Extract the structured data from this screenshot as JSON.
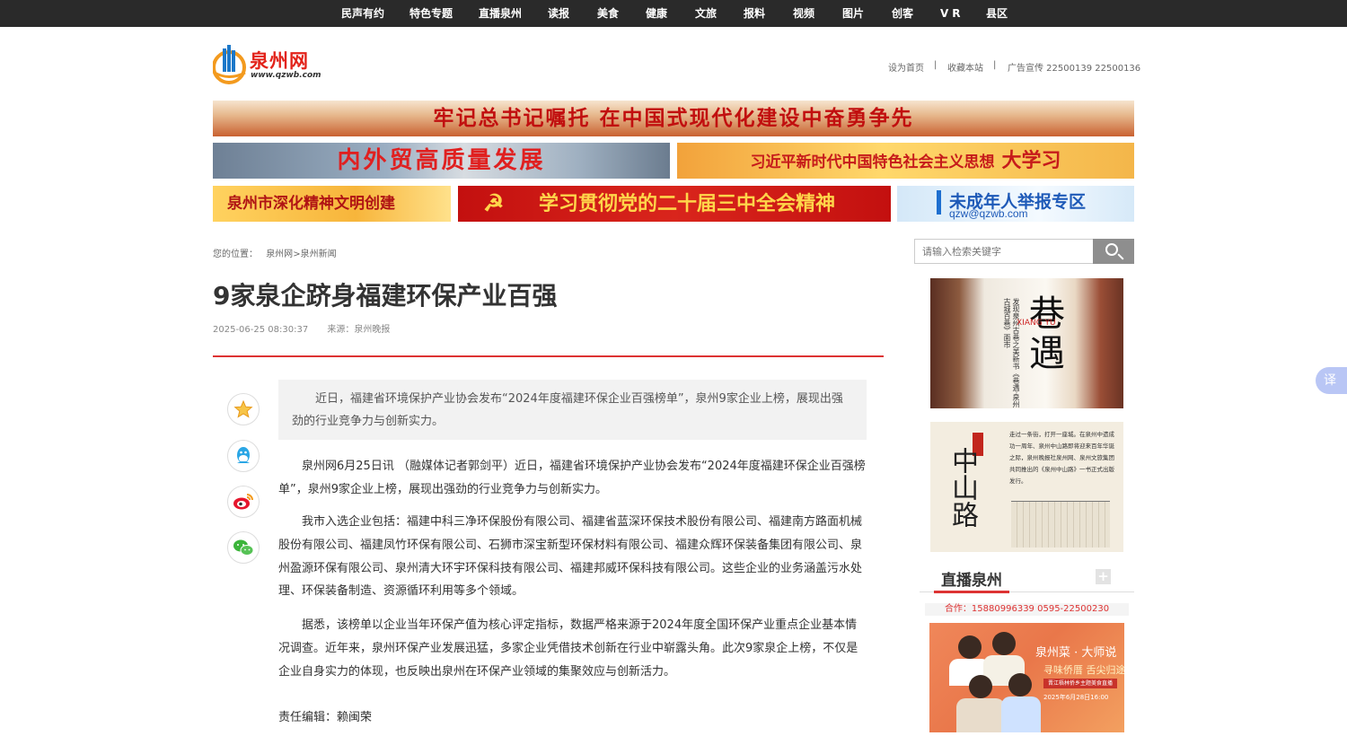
{
  "topnav": {
    "items": [
      "民声有约",
      "特色专题",
      "直播泉州",
      "读报",
      "美食",
      "健康",
      "文旅",
      "报料",
      "视频",
      "图片",
      "创客",
      "VR",
      "县区"
    ]
  },
  "header": {
    "logo_text": "泉州网",
    "logo_url": "www.qzwb.com",
    "links": [
      "设为首页",
      "收藏本站",
      "广告宣传 22500139 22500136"
    ],
    "separator": "|"
  },
  "banners": {
    "b1": "牢记总书记嘱托 在中国式现代化建设中奋勇争先",
    "b2": "内外贸高质量发展",
    "b3_small": "习近平新时代中国特色社会主义思想",
    "b3_big": "大学习",
    "b4": "泉州市深化精神文明创建",
    "b5": "学习贯彻党的二十届三中全会精神",
    "b6_title": "未成年人举报专区",
    "b6_email": "qzw@qzwb.com"
  },
  "breadcrumb": {
    "prefix": "您的位置：",
    "home": "泉州网",
    "sep": ">",
    "section": "泉州新闻"
  },
  "article": {
    "title": "9家泉企跻身福建环保产业百强",
    "datetime": "2025-06-25 08:30:37",
    "source_label": "来源：泉州晚报",
    "summary": "近日，福建省环境保护产业协会发布“2024年度福建环保企业百强榜单”，泉州9家企业上榜，展现出强劲的行业竞争力与创新实力。",
    "paragraphs": [
      "泉州网6月25日讯 （融媒体记者郭剑平）近日，福建省环境保护产业协会发布“2024年度福建环保企业百强榜单”，泉州9家企业上榜，展现出强劲的行业竞争力与创新实力。",
      "我市入选企业包括：福建中科三净环保股份有限公司、福建省蓝深环保技术股份有限公司、福建南方路面机械股份有限公司、福建凤竹环保有限公司、石狮市深宝新型环保材料有限公司、福建众辉环保装备集团有限公司、泉州盈源环保有限公司、泉州清大环宇环保科技有限公司、福建邦威环保科技有限公司。这些企业的业务涵盖污水处理、环保装备制造、资源循环利用等多个领域。",
      "据悉，该榜单以企业当年环保产值为核心评定指标，数据严格来源于2024年度全国环保产业重点企业基本情况调查。近年来，泉州环保产业发展迅猛，多家企业凭借技术创新在行业中崭露头角。此次9家泉企上榜，不仅是企业自身实力的体现，也反映出泉州在环保产业领域的集聚效应与创新活力。"
    ],
    "editor": "责任编辑：赖闽荣"
  },
  "share": {
    "icons": [
      "favorite-icon",
      "qq-icon",
      "weibo-icon",
      "wechat-icon"
    ]
  },
  "sidebar": {
    "search_placeholder": "请输入检索关键字",
    "ad1": {
      "calligraphy": "巷遇",
      "latin": "XIANG YU",
      "vertical_text": "发现泉州古巷之美新书《巷遇·泉州古城百巷》面市"
    },
    "ad2": {
      "title": "中山路",
      "text": "走过一条街，打开一座城。在泉州中遗成功一周年、泉州中山路即将迎来百年华诞之际，泉州晚报社泉州网、泉州文旅集团共同推出的《泉州中山路》一书正式出版发行。"
    },
    "live": {
      "title": "直播泉州",
      "plus": "+",
      "coop": "合作：15880996339 0595-22500230"
    },
    "ad3": {
      "line1": "泉州菜 · 大师说",
      "line2": "寻味侨厝 舌尖归途",
      "line3": "晋江梧林侨乡主题美食直播",
      "line4": "2025年6月28日16:00"
    }
  },
  "translate_label": "译"
}
